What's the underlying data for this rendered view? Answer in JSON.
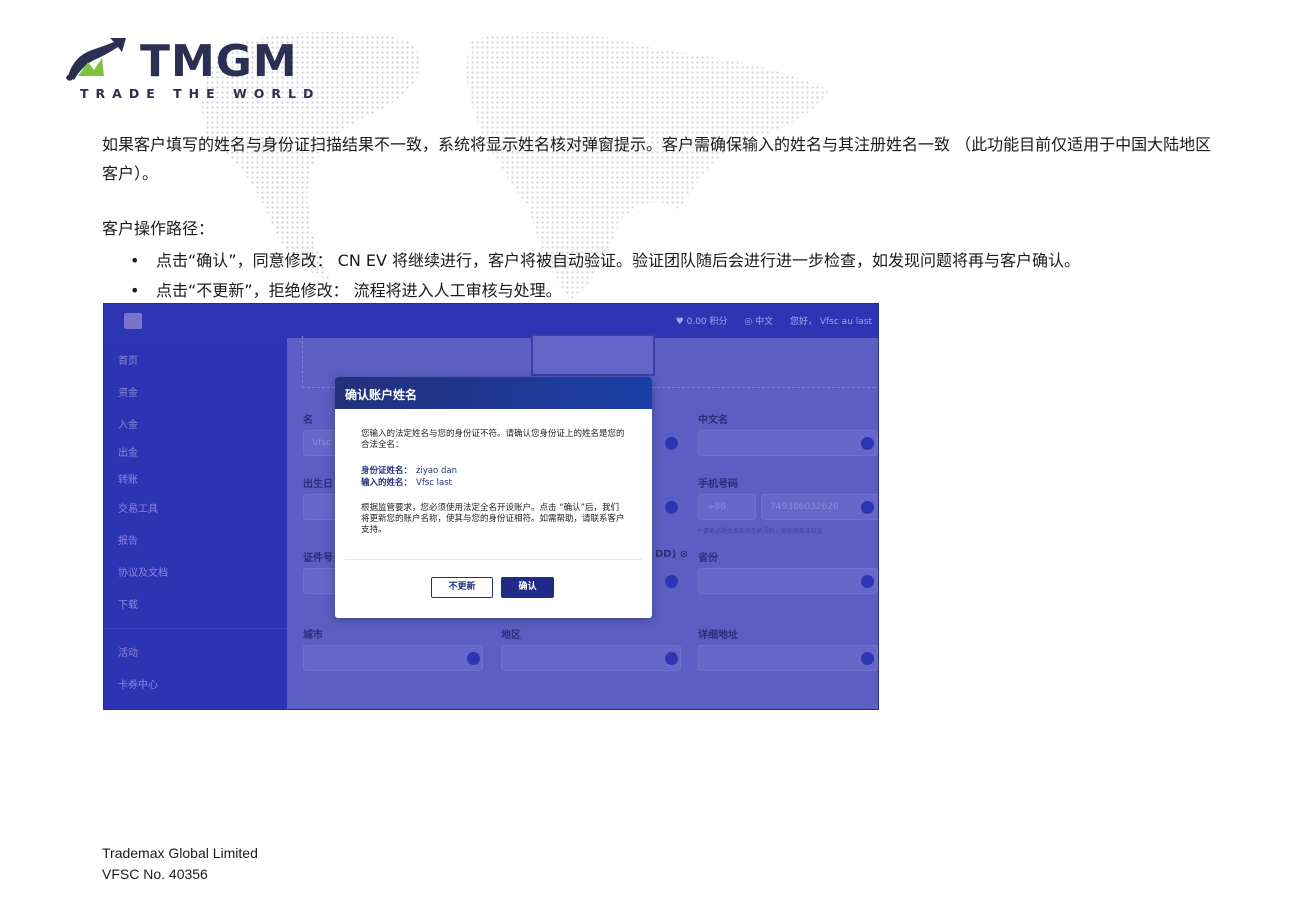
{
  "brand": {
    "name": "TMGM",
    "tagline": "TRADE THE WORLD",
    "colors": {
      "navy": "#2b2f52",
      "green": "#7fc241"
    }
  },
  "doc": {
    "paragraph": "如果客户填写的姓名与身份证扫描结果不一致，系统将显示姓名核对弹窗提示。客户需确保输入的姓名与其注册姓名一致 （此功能目前仅适用于中国大陆地区客户）。",
    "path_title": "客户操作路径：",
    "bullets": [
      "点击“确认”，同意修改： CN EV 将继续进行，客户将被自动验证。验证团队随后会进行进一步检查，如发现问题将再与客户确认。",
      "点击“不更新”，拒绝修改： 流程将进入人工审核与处理。"
    ]
  },
  "screenshot": {
    "topbar": {
      "points": "♥ 0.00 积分",
      "language": "◎ 中文",
      "greeting": "您好， Vfsc au last"
    },
    "sidebar": {
      "items": [
        "首页",
        "资金",
        "入金",
        "出金",
        "转账",
        "交易工具",
        "报告",
        "协议及文档",
        "下载",
        "活动",
        "卡券中心"
      ]
    },
    "form": {
      "labels": {
        "name": "名",
        "chinese_name": "中文名",
        "birth": "出生日",
        "phone": "手机号码",
        "id_no": "证件号",
        "dob_suffix": "DD) ⊙",
        "province": "省份",
        "city": "城市",
        "district": "地区",
        "address": "详细地址"
      },
      "values": {
        "name": "Vfsc",
        "phone_code": "+86",
        "phone_number": "749386032626",
        "phone_note": "* 请务必提供真实的手机号码，否则将无法验证"
      }
    },
    "modal": {
      "title": "确认账户姓名",
      "intro": "您输入的法定姓名与您的身份证不符。请确认您身份证上的姓名是您的合法全名：",
      "id_name_label": "身份证姓名：",
      "id_name_value": "ziyao dan",
      "input_name_label": "输入的姓名：",
      "input_name_value": "Vfsc last",
      "notice": "根据监管要求，您必须使用法定全名开设账户。点击 “确认”后，我们将更新您的账户名称，使其与您的身份证相符。如需帮助，请联系客户支持。",
      "btn_no_update": "不更新",
      "btn_confirm": "确认"
    }
  },
  "footer": {
    "company": "Trademax Global Limited",
    "license": "VFSC No. 40356"
  }
}
